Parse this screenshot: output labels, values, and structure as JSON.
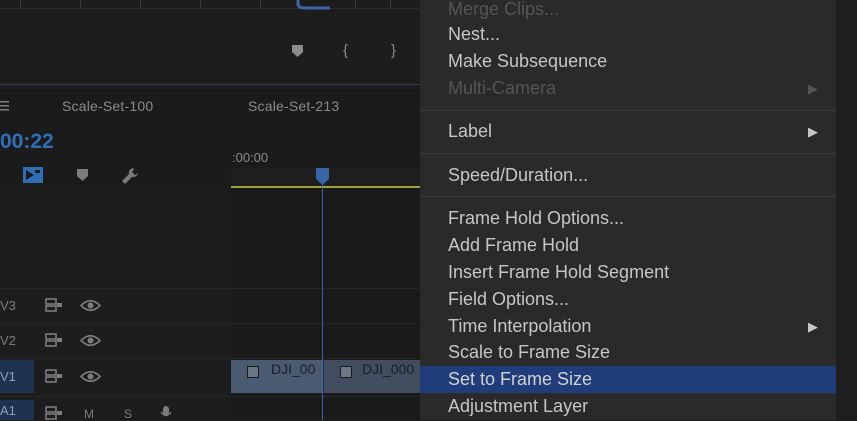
{
  "program_monitor": {
    "in_point_label": "{",
    "out_point_label": "}"
  },
  "timeline": {
    "menu_icon": "hamburger-icon",
    "tabs": [
      "Scale-Set-100",
      "Scale-Set-213"
    ],
    "timecode": "00:22",
    "ruler_start": ":00:00",
    "tracks": {
      "v3": "V3",
      "v2": "V2",
      "v1": "V1",
      "a1": "A1",
      "a1_mute": "M",
      "a1_solo": "S"
    },
    "clips": [
      {
        "name": "DJI_00"
      },
      {
        "name": "DJI_000"
      }
    ]
  },
  "context_menu": {
    "items": [
      {
        "label": "Merge Clips...",
        "disabled": true
      },
      {
        "label": "Nest...",
        "disabled": false
      },
      {
        "label": "Make Subsequence",
        "disabled": false
      },
      {
        "label": "Multi-Camera",
        "disabled": true,
        "submenu": true
      },
      {
        "label": "Label",
        "disabled": false,
        "submenu": true
      },
      {
        "label": "Speed/Duration...",
        "disabled": false
      },
      {
        "label": "Frame Hold Options...",
        "disabled": false
      },
      {
        "label": "Add Frame Hold",
        "disabled": false
      },
      {
        "label": "Insert Frame Hold Segment",
        "disabled": false
      },
      {
        "label": "Field Options...",
        "disabled": false
      },
      {
        "label": "Time Interpolation",
        "disabled": false,
        "submenu": true
      },
      {
        "label": "Scale to Frame Size",
        "disabled": false
      },
      {
        "label": "Set to Frame Size",
        "disabled": false,
        "selected": true
      },
      {
        "label": "Adjustment Layer",
        "disabled": false
      }
    ],
    "submenu_arrow": "▶"
  },
  "colors": {
    "accent": "#2f6fb8",
    "selection": "#1e3d7a",
    "work_area": "#a2a23a",
    "clip": "#4a5a70"
  }
}
